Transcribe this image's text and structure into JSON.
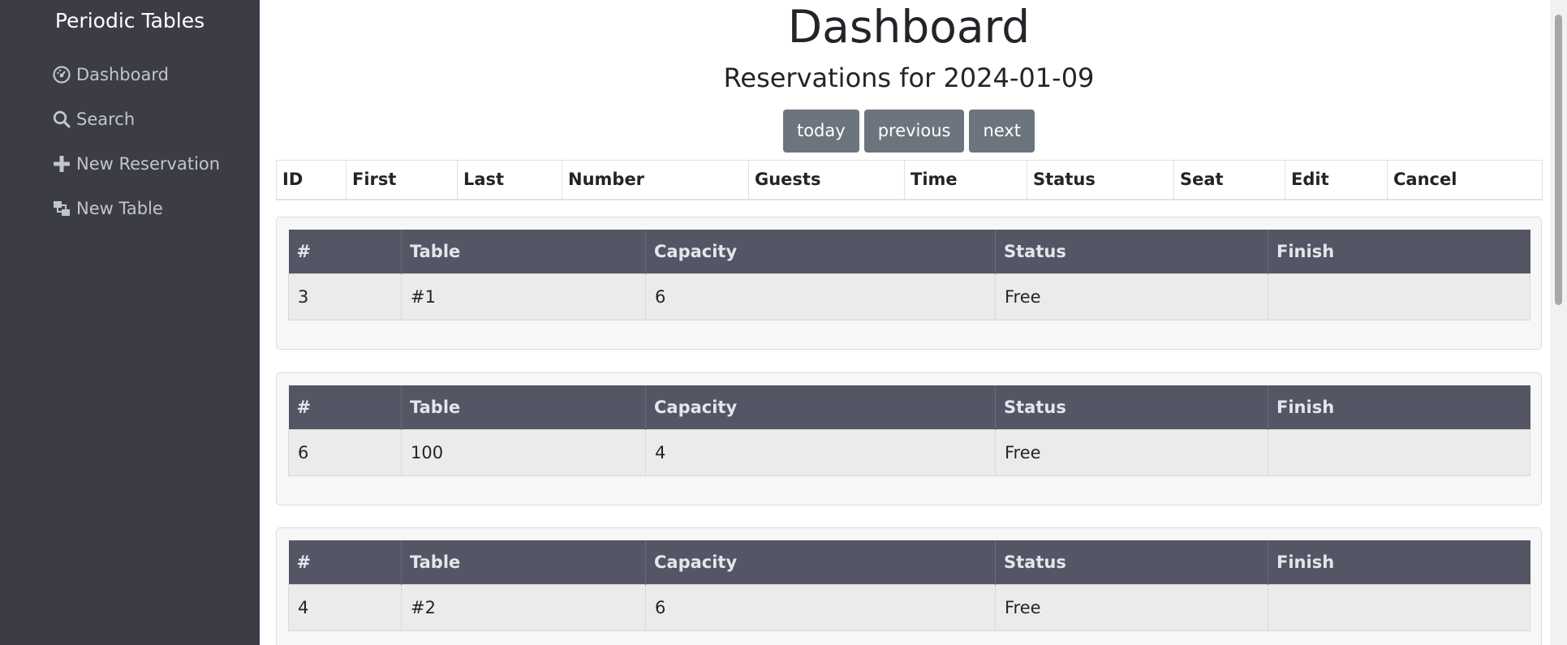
{
  "sidebar": {
    "brand": "Periodic Tables",
    "items": [
      {
        "label": "Dashboard",
        "icon": "dashboard-icon"
      },
      {
        "label": "Search",
        "icon": "search-icon"
      },
      {
        "label": "New Reservation",
        "icon": "plus-icon"
      },
      {
        "label": "New Table",
        "icon": "table-icon"
      }
    ]
  },
  "main": {
    "title": "Dashboard",
    "subtitle": "Reservations for 2024-01-09",
    "buttons": {
      "today": "today",
      "previous": "previous",
      "next": "next"
    },
    "reservations": {
      "headers": [
        "ID",
        "First",
        "Last",
        "Number",
        "Guests",
        "Time",
        "Status",
        "Seat",
        "Edit",
        "Cancel"
      ],
      "rows": []
    },
    "table_headers": [
      "#",
      "Table",
      "Capacity",
      "Status",
      "Finish"
    ],
    "tables": [
      {
        "id": "3",
        "name": "#1",
        "capacity": "6",
        "status": "Free",
        "finish": ""
      },
      {
        "id": "6",
        "name": "100",
        "capacity": "4",
        "status": "Free",
        "finish": ""
      },
      {
        "id": "4",
        "name": "#2",
        "capacity": "6",
        "status": "Free",
        "finish": ""
      }
    ]
  },
  "colors": {
    "sidebar_bg": "#3c3c47",
    "nav_text": "#c3c5cc",
    "button_bg": "#6c757d",
    "table_header_bg": "#545565",
    "row_bg": "#ebebeb",
    "card_bg": "#f7f7f7"
  }
}
